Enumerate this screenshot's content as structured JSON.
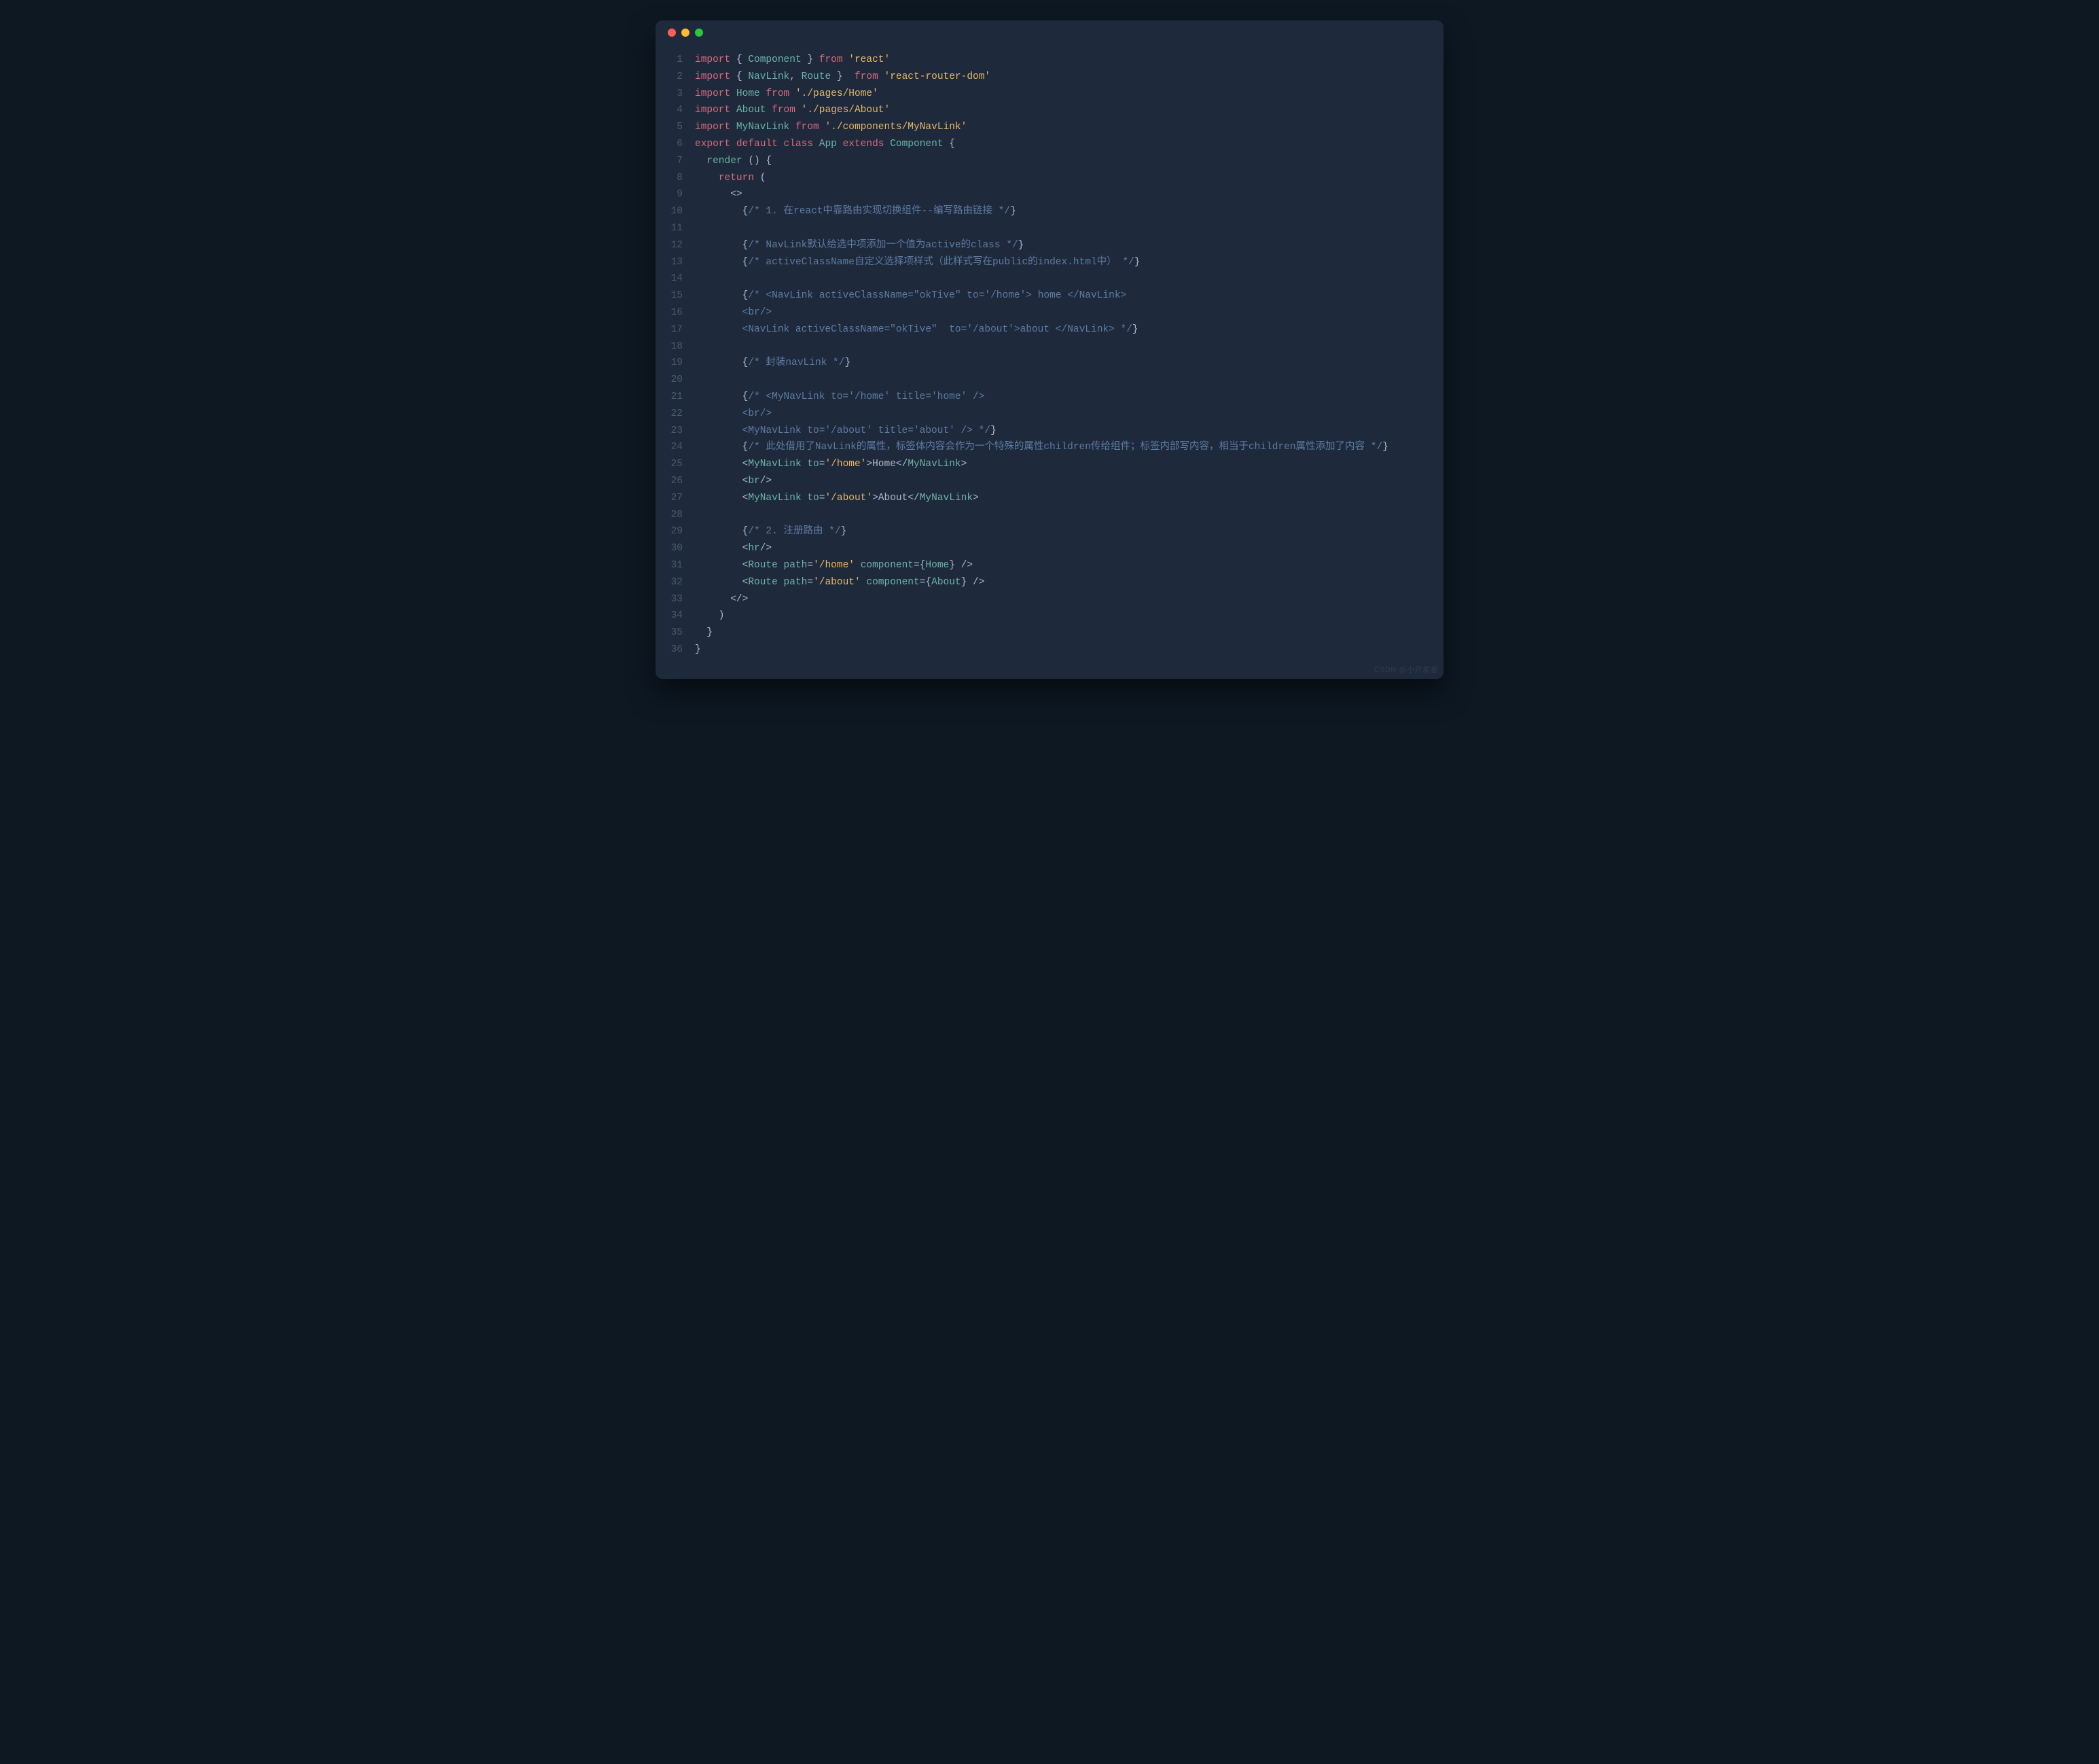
{
  "window": {
    "dots": [
      "red",
      "yellow",
      "green"
    ]
  },
  "code": {
    "lines": [
      {
        "n": 1,
        "tokens": [
          [
            "kw",
            "import"
          ],
          [
            "p",
            " { "
          ],
          [
            "cls",
            "Component"
          ],
          [
            "p",
            " } "
          ],
          [
            "fr",
            "from"
          ],
          [
            "p",
            " "
          ],
          [
            "str",
            "'react'"
          ]
        ]
      },
      {
        "n": 2,
        "tokens": [
          [
            "kw",
            "import"
          ],
          [
            "p",
            " { "
          ],
          [
            "cls",
            "NavLink"
          ],
          [
            "p",
            ", "
          ],
          [
            "cls",
            "Route"
          ],
          [
            "p",
            " }  "
          ],
          [
            "fr",
            "from"
          ],
          [
            "p",
            " "
          ],
          [
            "str",
            "'react-router-dom'"
          ]
        ]
      },
      {
        "n": 3,
        "tokens": [
          [
            "kw",
            "import"
          ],
          [
            "p",
            " "
          ],
          [
            "cls",
            "Home"
          ],
          [
            "p",
            " "
          ],
          [
            "fr",
            "from"
          ],
          [
            "p",
            " "
          ],
          [
            "str",
            "'./pages/Home'"
          ]
        ]
      },
      {
        "n": 4,
        "tokens": [
          [
            "kw",
            "import"
          ],
          [
            "p",
            " "
          ],
          [
            "cls",
            "About"
          ],
          [
            "p",
            " "
          ],
          [
            "fr",
            "from"
          ],
          [
            "p",
            " "
          ],
          [
            "str",
            "'./pages/About'"
          ]
        ]
      },
      {
        "n": 5,
        "tokens": [
          [
            "kw",
            "import"
          ],
          [
            "p",
            " "
          ],
          [
            "cls",
            "MyNavLink"
          ],
          [
            "p",
            " "
          ],
          [
            "fr",
            "from"
          ],
          [
            "p",
            " "
          ],
          [
            "str",
            "'./components/MyNavLink'"
          ]
        ]
      },
      {
        "n": 6,
        "tokens": [
          [
            "kw",
            "export"
          ],
          [
            "p",
            " "
          ],
          [
            "kw",
            "default"
          ],
          [
            "p",
            " "
          ],
          [
            "kw",
            "class"
          ],
          [
            "p",
            " "
          ],
          [
            "cls",
            "App"
          ],
          [
            "p",
            " "
          ],
          [
            "kw",
            "extends"
          ],
          [
            "p",
            " "
          ],
          [
            "cls",
            "Component"
          ],
          [
            "p",
            " {"
          ]
        ]
      },
      {
        "n": 7,
        "tokens": [
          [
            "p",
            "  "
          ],
          [
            "fn",
            "render"
          ],
          [
            "p",
            " () {"
          ]
        ]
      },
      {
        "n": 8,
        "tokens": [
          [
            "p",
            "    "
          ],
          [
            "kw",
            "return"
          ],
          [
            "p",
            " ("
          ]
        ]
      },
      {
        "n": 9,
        "tokens": [
          [
            "p",
            "      <>"
          ]
        ]
      },
      {
        "n": 10,
        "tokens": [
          [
            "p",
            "        {"
          ],
          [
            "cm",
            "/* 1. 在react中靠路由实现切换组件--编写路由链接 */"
          ],
          [
            "p",
            "}"
          ]
        ]
      },
      {
        "n": 11,
        "tokens": [
          [
            "p",
            ""
          ]
        ]
      },
      {
        "n": 12,
        "tokens": [
          [
            "p",
            "        {"
          ],
          [
            "cm",
            "/* NavLink默认给选中项添加一个值为active的class */"
          ],
          [
            "p",
            "}"
          ]
        ]
      },
      {
        "n": 13,
        "tokens": [
          [
            "p",
            "        {"
          ],
          [
            "cm",
            "/* activeClassName自定义选择项样式（此样式写在public的index.html中） */"
          ],
          [
            "p",
            "}"
          ]
        ]
      },
      {
        "n": 14,
        "tokens": [
          [
            "p",
            ""
          ]
        ]
      },
      {
        "n": 15,
        "tokens": [
          [
            "p",
            "        {"
          ],
          [
            "cm",
            "/* <NavLink activeClassName=\"okTive\" to='/home'> home </NavLink>"
          ]
        ]
      },
      {
        "n": 16,
        "tokens": [
          [
            "cm",
            "        <br/>"
          ]
        ]
      },
      {
        "n": 17,
        "tokens": [
          [
            "cm",
            "        <NavLink activeClassName=\"okTive\"  to='/about'>about </NavLink> */"
          ],
          [
            "p",
            "}"
          ]
        ]
      },
      {
        "n": 18,
        "tokens": [
          [
            "p",
            ""
          ]
        ]
      },
      {
        "n": 19,
        "tokens": [
          [
            "p",
            "        {"
          ],
          [
            "cm",
            "/* 封装navLink */"
          ],
          [
            "p",
            "}"
          ]
        ]
      },
      {
        "n": 20,
        "tokens": [
          [
            "p",
            ""
          ]
        ]
      },
      {
        "n": 21,
        "tokens": [
          [
            "p",
            "        {"
          ],
          [
            "cm",
            "/* <MyNavLink to='/home' title='home' />"
          ]
        ]
      },
      {
        "n": 22,
        "tokens": [
          [
            "cm",
            "        <br/>"
          ]
        ]
      },
      {
        "n": 23,
        "tokens": [
          [
            "cm",
            "        <MyNavLink to='/about' title='about' /> */"
          ],
          [
            "p",
            "}"
          ]
        ]
      },
      {
        "n": 24,
        "tokens": [
          [
            "p",
            "        {"
          ],
          [
            "cm",
            "/* 此处借用了NavLink的属性，标签体内容会作为一个特殊的属性children传给组件；标签内部写内容，相当于children属性添加了内容 */"
          ],
          [
            "p",
            "}"
          ]
        ]
      },
      {
        "n": 25,
        "tokens": [
          [
            "p",
            "        <"
          ],
          [
            "tag",
            "MyNavLink"
          ],
          [
            "p",
            " "
          ],
          [
            "attr",
            "to"
          ],
          [
            "p",
            "="
          ],
          [
            "str",
            "'/home'"
          ],
          [
            "p",
            ">"
          ],
          [
            "txt",
            "Home"
          ],
          [
            "p",
            "</"
          ],
          [
            "tag",
            "MyNavLink"
          ],
          [
            "p",
            ">"
          ]
        ]
      },
      {
        "n": 26,
        "tokens": [
          [
            "p",
            "        <"
          ],
          [
            "tag",
            "br"
          ],
          [
            "p",
            "/>"
          ]
        ]
      },
      {
        "n": 27,
        "tokens": [
          [
            "p",
            "        <"
          ],
          [
            "tag",
            "MyNavLink"
          ],
          [
            "p",
            " "
          ],
          [
            "attr",
            "to"
          ],
          [
            "p",
            "="
          ],
          [
            "str",
            "'/about'"
          ],
          [
            "p",
            ">"
          ],
          [
            "txt",
            "About"
          ],
          [
            "p",
            "</"
          ],
          [
            "tag",
            "MyNavLink"
          ],
          [
            "p",
            ">"
          ]
        ]
      },
      {
        "n": 28,
        "tokens": [
          [
            "p",
            ""
          ]
        ]
      },
      {
        "n": 29,
        "tokens": [
          [
            "p",
            "        {"
          ],
          [
            "cm",
            "/* 2. 注册路由 */"
          ],
          [
            "p",
            "}"
          ]
        ]
      },
      {
        "n": 30,
        "tokens": [
          [
            "p",
            "        <"
          ],
          [
            "tag",
            "hr"
          ],
          [
            "p",
            "/>"
          ]
        ]
      },
      {
        "n": 31,
        "tokens": [
          [
            "p",
            "        <"
          ],
          [
            "tag",
            "Route"
          ],
          [
            "p",
            " "
          ],
          [
            "attr",
            "path"
          ],
          [
            "p",
            "="
          ],
          [
            "str",
            "'/home'"
          ],
          [
            "p",
            " "
          ],
          [
            "attr",
            "component"
          ],
          [
            "p",
            "={"
          ],
          [
            "cls",
            "Home"
          ],
          [
            "p",
            "} />"
          ]
        ]
      },
      {
        "n": 32,
        "tokens": [
          [
            "p",
            "        <"
          ],
          [
            "tag",
            "Route"
          ],
          [
            "p",
            " "
          ],
          [
            "attr",
            "path"
          ],
          [
            "p",
            "="
          ],
          [
            "str",
            "'/about'"
          ],
          [
            "p",
            " "
          ],
          [
            "attr",
            "component"
          ],
          [
            "p",
            "={"
          ],
          [
            "cls",
            "About"
          ],
          [
            "p",
            "} />"
          ]
        ]
      },
      {
        "n": 33,
        "tokens": [
          [
            "p",
            "      </>"
          ]
        ]
      },
      {
        "n": 34,
        "tokens": [
          [
            "p",
            "    )"
          ]
        ]
      },
      {
        "n": 35,
        "tokens": [
          [
            "p",
            "  }"
          ]
        ]
      },
      {
        "n": 36,
        "tokens": [
          [
            "p",
            "}"
          ]
        ]
      }
    ]
  },
  "watermark": "CSDN @小开发者"
}
